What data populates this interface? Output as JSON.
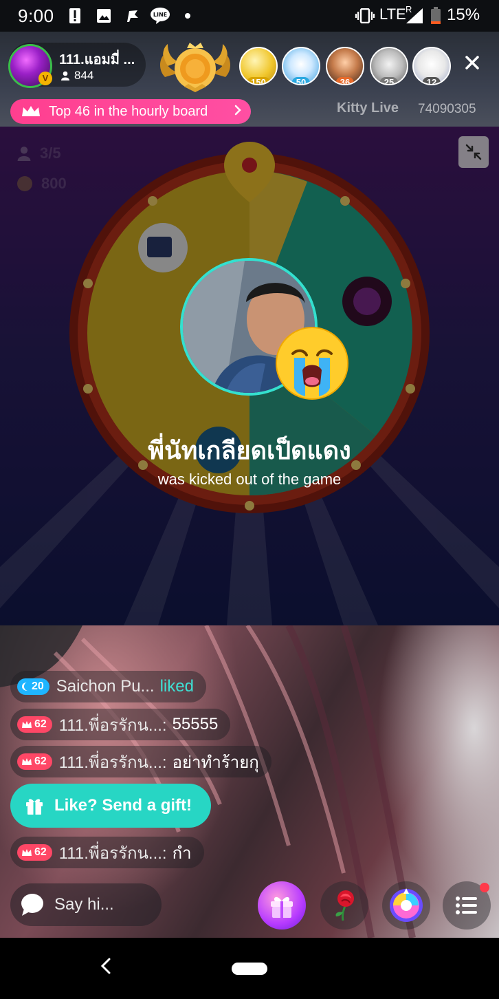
{
  "status_bar": {
    "time": "9:00",
    "network": "LTE",
    "network_sup": "R",
    "battery": "15%",
    "notification_icons": [
      "alert-icon",
      "image-icon",
      "flag-icon",
      "line-icon",
      "dot-icon"
    ]
  },
  "header": {
    "host_name": "111.แอมมี่ ...",
    "viewer_count": "844",
    "fans": [
      {
        "count": "150",
        "badge_color": "#d9a400"
      },
      {
        "count": "50",
        "badge_color": "#2aa8e0"
      },
      {
        "count": "36",
        "badge_color": "#e86a2a"
      },
      {
        "count": "25",
        "badge_color": "#777777"
      },
      {
        "count": "12",
        "badge_color": "#555555"
      }
    ],
    "hourly_board_label": "Top 46 in the hourly board",
    "brand": "Kitty Live",
    "room_id": "74090305"
  },
  "game": {
    "players": "3/5",
    "coins": "800",
    "kicked_name": "พี่นัทเกลียดเป็ดแดง",
    "kicked_message": "was kicked out of the game"
  },
  "chat": {
    "messages": [
      {
        "level": "20",
        "user": "Saichon Pu...",
        "text": "liked"
      },
      {
        "level": "62",
        "user": "111.พี่อรรักน...:",
        "text": "55555"
      },
      {
        "level": "62",
        "user": "111.พี่อรรักน...:",
        "text": "อย่าทำร้ายกุ"
      },
      {
        "level": "62",
        "user": "111.พี่อรรักน...:",
        "text": "กำ"
      }
    ],
    "gift_prompt": "Like? Send a gift!",
    "input_placeholder": "Say hi..."
  },
  "colors": {
    "accent_pink": "#ff4fa3",
    "accent_teal": "#27d6c4",
    "liked_text": "#3fe0d4",
    "level_blue": "#1fb5ff",
    "level_red": "#ff4766"
  }
}
